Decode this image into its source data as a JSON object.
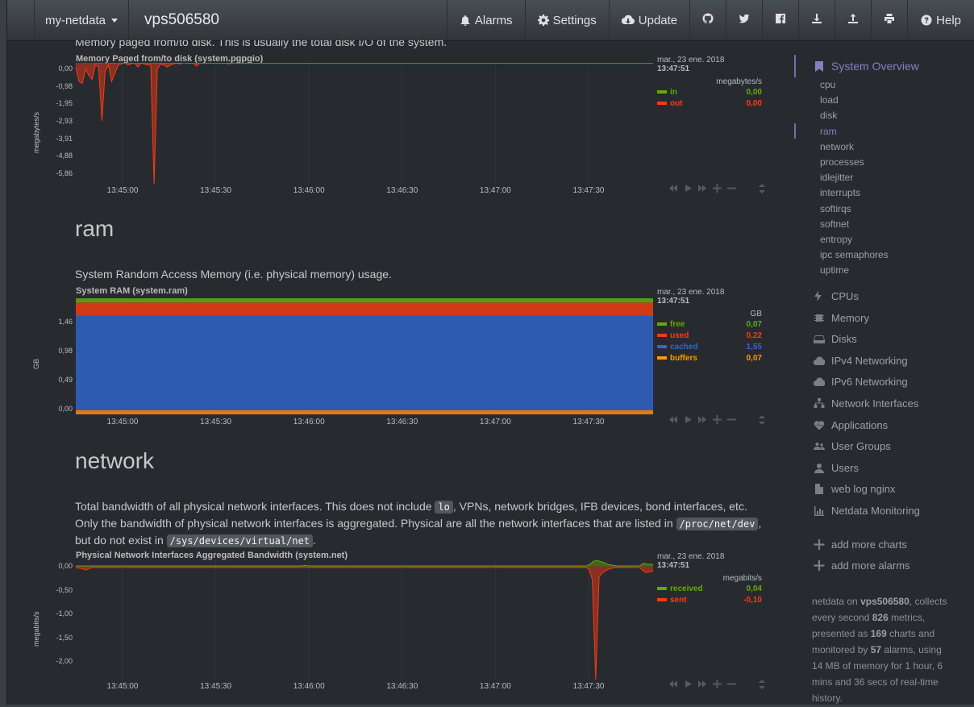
{
  "navbar": {
    "server_dropdown": "my-netdata",
    "hostname": "vps506580",
    "alarms": "Alarms",
    "settings": "Settings",
    "update": "Update",
    "help": "Help"
  },
  "sections": {
    "pgpgio_desc": "Memory paged from/to disk. This is usually the total disk I/O of the system.",
    "ram_title": "ram",
    "ram_desc": "System Random Access Memory (i.e. physical memory) usage.",
    "network_title": "network",
    "network_desc_1": "Total bandwidth of all physical network interfaces. This does not include",
    "network_code_lo": "lo",
    "network_desc_2": ", VPNs, network bridges, IFB devices, bond interfaces, etc.",
    "network_desc_3": "Only the bandwidth of physical network interfaces is aggregated. Physical are all the network interfaces that are listed in",
    "network_code_proc": "/proc/net/dev",
    "network_desc_4": ",",
    "network_desc_5": "but do not exist in",
    "network_code_sys": "/sys/devices/virtual/net",
    "network_desc_6": "."
  },
  "chart_data": [
    {
      "type": "area",
      "title": "Memory Paged from/to disk (system.pgpgio)",
      "ylabel": "megabytes/s",
      "yticks": [
        "0,00",
        "-0,98",
        "-1,95",
        "-2,93",
        "-3,91",
        "-4,88",
        "-5,86"
      ],
      "ylim": [
        -5.86,
        0
      ],
      "x_labels": [
        "13:45:00",
        "13:45:30",
        "13:46:00",
        "13:46:30",
        "13:47:00",
        "13:47:30"
      ],
      "legend": {
        "date": "mar., 23 ene. 2018",
        "time": "13:47:51",
        "unit": "megabytes/s",
        "items": [
          {
            "name": "in",
            "value": "0,00",
            "color": "#66aa00"
          },
          {
            "name": "out",
            "value": "0,00",
            "color": "#fe3912"
          }
        ]
      },
      "series": [
        {
          "name": "in",
          "color": "#66aa00",
          "values": [
            0.08,
            0.35,
            0.1,
            0.0,
            0.05,
            0.02,
            0.0,
            0.0,
            0.0,
            0.05,
            0.0,
            0.0,
            0.0,
            0.0,
            0.0,
            0.03,
            0.0,
            0.0,
            0.0,
            0.0,
            0.0,
            0.0,
            0.0,
            0.0,
            0.0,
            0.0,
            0.0,
            0.0,
            0.0,
            0.0,
            0.0,
            0.0,
            0.0,
            0.0,
            0.0,
            0.0,
            0.0,
            0.0,
            0.0,
            0.0,
            0.0,
            0.02,
            0.0,
            0.0,
            0.0,
            0.0,
            0.0,
            0.0,
            0.0,
            0.0,
            0.0,
            0.0,
            0.0,
            0.0,
            0.0,
            0.0,
            0.0,
            0.0,
            0.0,
            0.0,
            0.0,
            0.0,
            0.0,
            0.0,
            0.0,
            0.0,
            0.0,
            0.0,
            0.0,
            0.0,
            0.0,
            0.0,
            0.0,
            0.0,
            0.0,
            0.0,
            0.0,
            0.0,
            0.0,
            0.0,
            0.0,
            0.0,
            0.0,
            0.0,
            0.0,
            0.0,
            0.0,
            0.0,
            0.0,
            0.0,
            0.0,
            0.0,
            0.0,
            0.0,
            0.0,
            0.0,
            0.0,
            0.0,
            0.0,
            0.0,
            0.0,
            0.0,
            0.0,
            0.0,
            0.0,
            0.0,
            0.0,
            0.0,
            0.0,
            0.0,
            0.0,
            0.0,
            0.0,
            0.0,
            0.0,
            0.0,
            0.0,
            0.0,
            0.0,
            0.0,
            0.0,
            0.0,
            0.0,
            0.0,
            0.0,
            0.0,
            0.0,
            0.0,
            0.0,
            0.0,
            0.0,
            0.0,
            0.0,
            0.0,
            0.0,
            0.0,
            0.0,
            0.0,
            0.0,
            0.0,
            0.0,
            0.35,
            0.0,
            0.0,
            0.0,
            0.0,
            0.0,
            0.0,
            0.0,
            0.0,
            0.0,
            0.0,
            0.0,
            0.0,
            0.0,
            0.0,
            0.0,
            0.0,
            0.0,
            0.0,
            0.0,
            0.0,
            0.0,
            0.0,
            0.0,
            0.0,
            0.0,
            0.0,
            0.0,
            0.0,
            0.0,
            0.0,
            0.0,
            0.0,
            0.0,
            0.0,
            0.0,
            0.0
          ]
        },
        {
          "name": "out",
          "color": "#fe3912",
          "values": [
            -0.2,
            -0.9,
            -1.0,
            -0.3,
            -0.6,
            -0.8,
            -0.1,
            -0.2,
            -2.8,
            -0.4,
            -0.1,
            -0.9,
            -0.5,
            -0.1,
            -0.05,
            0.0,
            -0.1,
            -0.05,
            0.0,
            -0.2,
            -0.02,
            -0.05,
            -0.1,
            -0.1,
            -5.9,
            -0.3,
            -0.05,
            -0.1,
            -0.2,
            -0.1,
            -0.05,
            -0.02,
            -0.05,
            0.0,
            -0.02,
            -0.02,
            -0.02,
            -0.15,
            -0.02,
            -0.02,
            -0.02,
            -0.02,
            -0.02,
            -0.02,
            -0.02,
            -0.02,
            -0.02,
            -0.05,
            -0.02,
            -0.02,
            -0.02,
            -0.02,
            -0.02,
            -0.02,
            -0.02,
            -0.02,
            -0.02,
            -0.02,
            -0.02,
            -0.02,
            -0.02,
            -0.02,
            -0.02,
            -0.02,
            -0.02,
            -0.02,
            -0.02,
            -0.02,
            -0.02,
            -0.02,
            -0.02,
            -0.02,
            -0.02,
            -0.02,
            -0.02,
            -0.02,
            -0.02,
            -0.02,
            -0.02,
            -0.02,
            -0.02,
            -0.02,
            -0.02,
            -0.02,
            -0.02,
            -0.02,
            -0.02,
            -0.02,
            -0.02,
            -0.02,
            -0.02,
            -0.02,
            -0.02,
            -0.02,
            -0.02,
            -0.02,
            -0.02,
            -0.02,
            -0.02,
            -0.02,
            -0.02,
            -0.02,
            -0.02,
            -0.02,
            -0.02,
            -0.02,
            -0.02,
            -0.02,
            -0.02,
            -0.02,
            -0.02,
            -0.02,
            -0.02,
            -0.02,
            -0.02,
            -0.02,
            -0.02,
            -0.02,
            -0.02,
            -0.02,
            -0.02,
            -0.02,
            -0.02,
            -0.02,
            -0.02,
            -0.02,
            -0.02,
            -0.02,
            -0.02,
            -0.02,
            -0.02,
            -0.02,
            -0.02,
            -0.02,
            -0.02,
            -0.02,
            -0.02,
            -0.02,
            -0.02,
            -0.02,
            -0.02,
            -0.02,
            -0.02,
            -0.02,
            -0.02,
            -0.02,
            -0.02,
            -0.02,
            -0.02,
            -0.02,
            -0.02,
            -0.02,
            -0.02,
            -0.02,
            -0.02,
            -0.02,
            -0.02,
            -0.02,
            -0.02,
            -0.02,
            -0.02,
            -0.02,
            -0.02,
            -0.02,
            -0.02,
            -0.02,
            -0.02,
            -0.02,
            -0.02,
            -0.02,
            -0.02,
            -0.02,
            -0.02,
            -0.02,
            -0.02,
            -0.02,
            -0.02,
            -0.02
          ]
        }
      ]
    },
    {
      "type": "area",
      "title": "System RAM (system.ram)",
      "ylabel": "GB",
      "yticks": [
        "1,46",
        "0,98",
        "0,49",
        "0,00"
      ],
      "ylim": [
        0,
        1.91
      ],
      "x_labels": [
        "13:45:00",
        "13:45:30",
        "13:46:00",
        "13:46:30",
        "13:47:00",
        "13:47:30"
      ],
      "legend": {
        "date": "mar., 23 ene. 2018",
        "time": "13:47:51",
        "unit": "GB",
        "items": [
          {
            "name": "free",
            "value": "0,07",
            "color": "#66aa00"
          },
          {
            "name": "used",
            "value": "0,22",
            "color": "#fe3912"
          },
          {
            "name": "cached",
            "value": "1,55",
            "color": "#3366cc"
          },
          {
            "name": "buffers",
            "value": "0,07",
            "color": "#ff9900"
          }
        ]
      },
      "stack_order": [
        "buffers",
        "cached",
        "used",
        "free"
      ],
      "values": {
        "free": 0.07,
        "used": 0.22,
        "cached": 1.55,
        "buffers": 0.07
      }
    },
    {
      "type": "area",
      "title": "Physical Network Interfaces Aggregated Bandwidth (system.net)",
      "ylabel": "megabits/s",
      "yticks": [
        "0,00",
        "-0,50",
        "-1,00",
        "-1,50",
        "-2,00"
      ],
      "ylim": [
        -2.2,
        0.12
      ],
      "x_labels": [
        "13:45:00",
        "13:45:30",
        "13:46:00",
        "13:46:30",
        "13:47:00",
        "13:47:30"
      ],
      "legend": {
        "date": "mar., 23 ene. 2018",
        "time": "13:47:51",
        "unit": "megabits/s",
        "items": [
          {
            "name": "received",
            "value": "0,04",
            "color": "#66aa00"
          },
          {
            "name": "sent",
            "value": "-0,10",
            "color": "#fe3912"
          }
        ]
      },
      "series": [
        {
          "name": "received",
          "color": "#66aa00",
          "values": [
            0.01,
            0.01,
            0.01,
            0.01,
            0.01,
            0.01,
            0.01,
            0.01,
            0.01,
            0.01,
            0.01,
            0.01,
            0.01,
            0.01,
            0.01,
            0.01,
            0.01,
            0.01,
            0.01,
            0.01,
            0.01,
            0.01,
            0.01,
            0.01,
            0.01,
            0.01,
            0.01,
            0.01,
            0.01,
            0.01,
            0.01,
            0.01,
            0.01,
            0.01,
            0.01,
            0.01,
            0.01,
            0.01,
            0.01,
            0.01,
            0.01,
            0.01,
            0.01,
            0.01,
            0.01,
            0.01,
            0.01,
            0.01,
            0.01,
            0.01,
            0.01,
            0.01,
            0.01,
            0.01,
            0.01,
            0.01,
            0.01,
            0.01,
            0.01,
            0.01,
            0.01,
            0.01,
            0.01,
            0.01,
            0.01,
            0.01,
            0.01,
            0.01,
            0.01,
            0.02,
            0.01,
            0.01,
            0.01,
            0.01,
            0.01,
            0.01,
            0.01,
            0.01,
            0.01,
            0.01,
            0.01,
            0.01,
            0.01,
            0.01,
            0.01,
            0.01,
            0.01,
            0.01,
            0.01,
            0.01,
            0.01,
            0.01,
            0.01,
            0.01,
            0.01,
            0.01,
            0.01,
            0.01,
            0.01,
            0.01,
            0.01,
            0.01,
            0.01,
            0.01,
            0.01,
            0.01,
            0.01,
            0.01,
            0.01,
            0.01,
            0.01,
            0.01,
            0.01,
            0.01,
            0.01,
            0.01,
            0.01,
            0.01,
            0.01,
            0.01,
            0.01,
            0.01,
            0.01,
            0.01,
            0.01,
            0.01,
            0.01,
            0.01,
            0.01,
            0.01,
            0.01,
            0.01,
            0.01,
            0.01,
            0.01,
            0.01,
            0.01,
            0.01,
            0.01,
            0.01,
            0.01,
            0.01,
            0.01,
            0.01,
            0.01,
            0.01,
            0.01,
            0.01,
            0.01,
            0.01,
            0.01,
            0.01,
            0.01,
            0.01,
            0.01,
            0.04,
            0.1,
            0.12,
            0.1,
            0.08,
            0.05,
            0.03,
            0.02,
            0.01,
            0.01,
            0.01,
            0.01,
            0.01,
            0.01,
            0.01,
            0.01,
            0.06,
            0.05,
            0.04,
            0.04
          ]
        },
        {
          "name": "sent",
          "color": "#fe3912",
          "values": [
            -0.03,
            -0.03,
            -0.05,
            -0.07,
            -0.04,
            -0.02,
            -0.02,
            -0.02,
            -0.02,
            -0.02,
            -0.02,
            -0.02,
            -0.02,
            -0.02,
            -0.02,
            -0.02,
            -0.02,
            -0.02,
            -0.02,
            -0.02,
            -0.02,
            -0.02,
            -0.02,
            -0.02,
            -0.02,
            -0.02,
            -0.02,
            -0.02,
            -0.02,
            -0.02,
            -0.02,
            -0.02,
            -0.02,
            -0.02,
            -0.02,
            -0.02,
            -0.02,
            -0.02,
            -0.02,
            -0.02,
            -0.02,
            -0.02,
            -0.02,
            -0.02,
            -0.02,
            -0.02,
            -0.02,
            -0.02,
            -0.02,
            -0.02,
            -0.02,
            -0.02,
            -0.02,
            -0.02,
            -0.02,
            -0.02,
            -0.02,
            -0.02,
            -0.02,
            -0.02,
            -0.02,
            -0.02,
            -0.02,
            -0.02,
            -0.02,
            -0.02,
            -0.02,
            -0.02,
            -0.02,
            -0.02,
            -0.02,
            -0.02,
            -0.02,
            -0.02,
            -0.02,
            -0.02,
            -0.02,
            -0.02,
            -0.02,
            -0.02,
            -0.02,
            -0.02,
            -0.02,
            -0.02,
            -0.02,
            -0.02,
            -0.02,
            -0.02,
            -0.02,
            -0.02,
            -0.02,
            -0.02,
            -0.02,
            -0.02,
            -0.02,
            -0.02,
            -0.02,
            -0.02,
            -0.02,
            -0.02,
            -0.02,
            -0.02,
            -0.02,
            -0.02,
            -0.02,
            -0.02,
            -0.02,
            -0.02,
            -0.02,
            -0.02,
            -0.02,
            -0.02,
            -0.02,
            -0.02,
            -0.02,
            -0.02,
            -0.02,
            -0.02,
            -0.02,
            -0.02,
            -0.02,
            -0.02,
            -0.02,
            -0.02,
            -0.02,
            -0.02,
            -0.02,
            -0.02,
            -0.02,
            -0.02,
            -0.02,
            -0.02,
            -0.02,
            -0.02,
            -0.02,
            -0.02,
            -0.02,
            -0.02,
            -0.02,
            -0.02,
            -0.02,
            -0.02,
            -0.02,
            -0.02,
            -0.02,
            -0.02,
            -0.02,
            -0.02,
            -0.02,
            -0.02,
            -0.02,
            -0.02,
            -0.05,
            -0.25,
            -2.2,
            -0.2,
            -0.12,
            -0.08,
            -0.05,
            -0.03,
            -0.02,
            -0.02,
            -0.02,
            -0.02,
            -0.02,
            -0.02,
            -0.02,
            -0.02,
            -0.08,
            -0.12,
            -0.1,
            -0.1
          ]
        }
      ]
    }
  ],
  "sidebar": {
    "top": "System Overview",
    "subitems": [
      "cpu",
      "load",
      "disk",
      "ram",
      "network",
      "processes",
      "idlejitter",
      "interrupts",
      "softirqs",
      "softnet",
      "entropy",
      "ipc semaphores",
      "uptime"
    ],
    "active_sub": "ram",
    "items": [
      {
        "label": "CPUs",
        "icon": "bolt-icon"
      },
      {
        "label": "Memory",
        "icon": "chip-icon"
      },
      {
        "label": "Disks",
        "icon": "hdd-icon"
      },
      {
        "label": "IPv4 Networking",
        "icon": "cloud-icon"
      },
      {
        "label": "IPv6 Networking",
        "icon": "cloud-icon"
      },
      {
        "label": "Network Interfaces",
        "icon": "sitemap-icon"
      },
      {
        "label": "Applications",
        "icon": "heartbeat-icon"
      },
      {
        "label": "User Groups",
        "icon": "users-icon"
      },
      {
        "label": "Users",
        "icon": "user-icon"
      },
      {
        "label": "web log nginx",
        "icon": "file-icon"
      },
      {
        "label": "Netdata Monitoring",
        "icon": "chart-icon"
      }
    ],
    "add_charts": "add more charts",
    "add_alarms": "add more alarms",
    "footer": {
      "t1": "netdata on ",
      "host": "vps506580",
      "t2": ", collects every second ",
      "metrics": "826",
      "t3": " metrics, presented as ",
      "charts": "169",
      "t4": " charts and monitored by ",
      "alarms": "57",
      "t5": " alarms, using 14 MB of memory for 1 hour, 6 mins and 36 secs of real-time history."
    }
  }
}
